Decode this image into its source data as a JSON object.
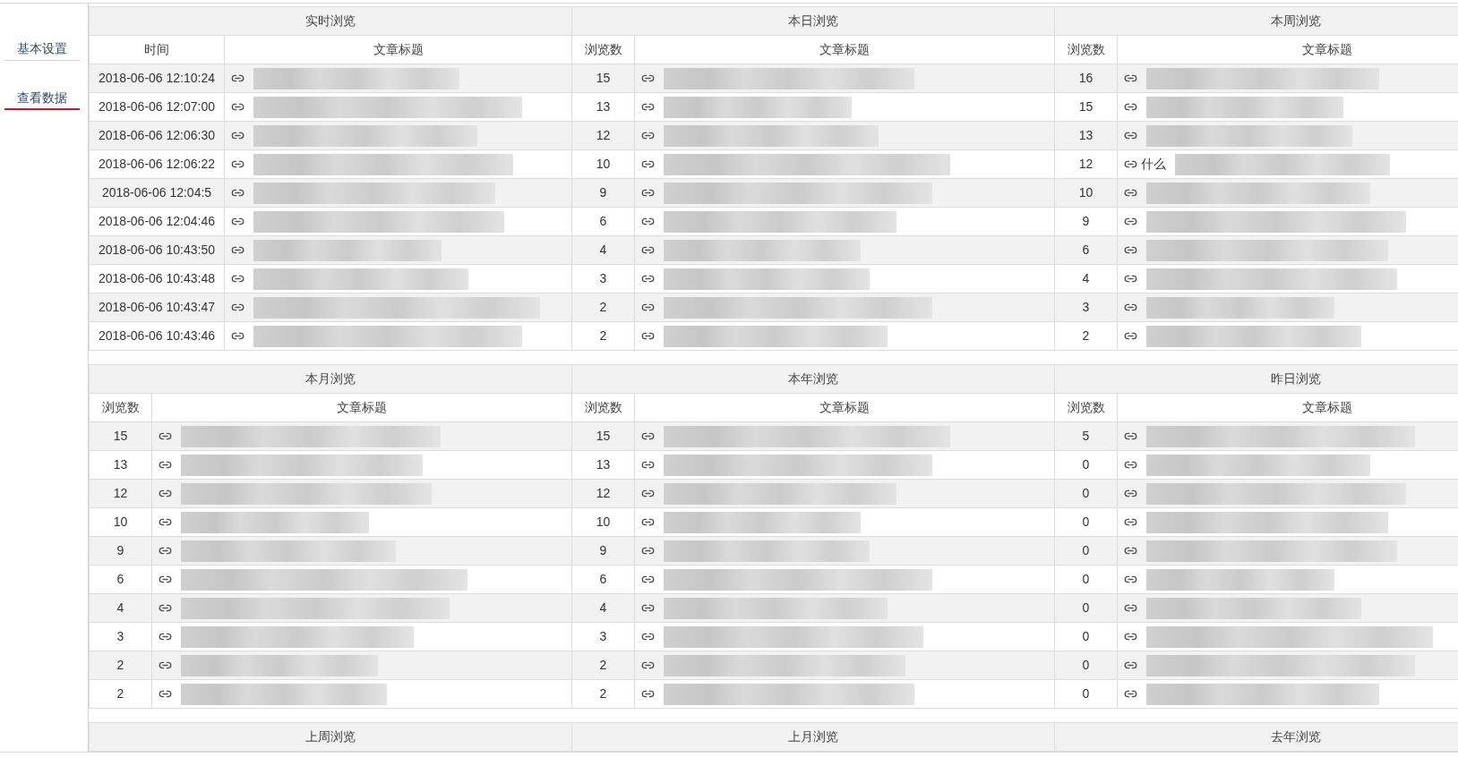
{
  "sidebar": {
    "items": [
      {
        "label": "基本设置",
        "selected": false
      },
      {
        "label": "查看数据",
        "selected": true
      }
    ]
  },
  "blocks": [
    {
      "panels": [
        {
          "title": "实时浏览",
          "kind": "recent",
          "columns": [
            "时间",
            "文章标题"
          ],
          "rows": [
            {
              "value": "2018-06-06 12:10:24"
            },
            {
              "value": "2018-06-06 12:07:00"
            },
            {
              "value": "2018-06-06 12:06:30"
            },
            {
              "value": "2018-06-06 12:06:22"
            },
            {
              "value": "2018-06-06 12:04:5"
            },
            {
              "value": "2018-06-06 12:04:46"
            },
            {
              "value": "2018-06-06 10:43:50"
            },
            {
              "value": "2018-06-06 10:43:48"
            },
            {
              "value": "2018-06-06 10:43:47"
            },
            {
              "value": "2018-06-06 10:43:46"
            }
          ]
        },
        {
          "title": "本日浏览",
          "kind": "count",
          "columns": [
            "浏览数",
            "文章标题"
          ],
          "rows": [
            {
              "value": "15"
            },
            {
              "value": "13"
            },
            {
              "value": "12"
            },
            {
              "value": "10"
            },
            {
              "value": "9"
            },
            {
              "value": "6"
            },
            {
              "value": "4"
            },
            {
              "value": "3"
            },
            {
              "value": "2"
            },
            {
              "value": "2"
            }
          ]
        },
        {
          "title": "本周浏览",
          "kind": "count",
          "columns": [
            "浏览数",
            "文章标题"
          ],
          "rows": [
            {
              "value": "16"
            },
            {
              "value": "15"
            },
            {
              "value": "13"
            },
            {
              "value": "12",
              "title_fragment": "什么"
            },
            {
              "value": "10"
            },
            {
              "value": "9"
            },
            {
              "value": "6"
            },
            {
              "value": "4"
            },
            {
              "value": "3"
            },
            {
              "value": "2"
            }
          ]
        }
      ]
    },
    {
      "panels": [
        {
          "title": "本月浏览",
          "kind": "count",
          "columns": [
            "浏览数",
            "文章标题"
          ],
          "rows": [
            {
              "value": "15"
            },
            {
              "value": "13"
            },
            {
              "value": "12"
            },
            {
              "value": "10"
            },
            {
              "value": "9"
            },
            {
              "value": "6"
            },
            {
              "value": "4"
            },
            {
              "value": "3"
            },
            {
              "value": "2"
            },
            {
              "value": "2"
            }
          ]
        },
        {
          "title": "本年浏览",
          "kind": "count",
          "columns": [
            "浏览数",
            "文章标题"
          ],
          "rows": [
            {
              "value": "15"
            },
            {
              "value": "13"
            },
            {
              "value": "12"
            },
            {
              "value": "10"
            },
            {
              "value": "9"
            },
            {
              "value": "6"
            },
            {
              "value": "4"
            },
            {
              "value": "3"
            },
            {
              "value": "2"
            },
            {
              "value": "2"
            }
          ]
        },
        {
          "title": "昨日浏览",
          "kind": "count",
          "columns": [
            "浏览数",
            "文章标题"
          ],
          "rows": [
            {
              "value": "5"
            },
            {
              "value": "0"
            },
            {
              "value": "0"
            },
            {
              "value": "0"
            },
            {
              "value": "0"
            },
            {
              "value": "0"
            },
            {
              "value": "0"
            },
            {
              "value": "0"
            },
            {
              "value": "0"
            },
            {
              "value": "0"
            }
          ]
        }
      ]
    },
    {
      "panels": [
        {
          "title": "上周浏览",
          "kind": "count"
        },
        {
          "title": "上月浏览",
          "kind": "count"
        },
        {
          "title": "去年浏览",
          "kind": "count"
        }
      ]
    }
  ]
}
